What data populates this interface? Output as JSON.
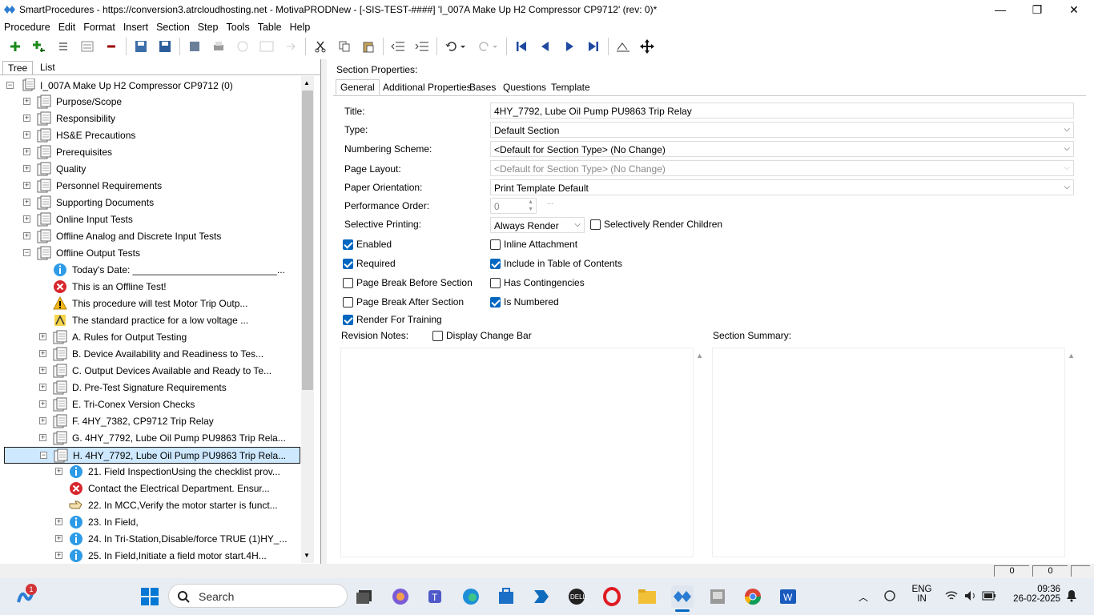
{
  "window": {
    "title": "SmartProcedures - https://conversion3.atrcloudhosting.net - MotivaPRODNew - [-SIS-TEST-####] 'I_007A Make Up H2 Compressor CP9712' (rev: 0)*",
    "minimize": "—",
    "maximize": "❐",
    "close": "✕"
  },
  "menu": [
    "Procedure",
    "Edit",
    "Format",
    "Insert",
    "Section",
    "Step",
    "Tools",
    "Table",
    "Help"
  ],
  "left_tabs": {
    "tree": "Tree",
    "list": "List"
  },
  "tree": {
    "root": "I_007A Make Up H2 Compressor CP9712 (0)",
    "rows": [
      {
        "label": "Purpose/Scope",
        "icon": "section-icon",
        "level": 1,
        "exp": "+"
      },
      {
        "label": "Responsibility",
        "icon": "section-icon",
        "level": 1,
        "exp": "+"
      },
      {
        "label": "HS&E Precautions",
        "icon": "section-icon",
        "level": 1,
        "exp": "+"
      },
      {
        "label": "Prerequisites",
        "icon": "section-icon",
        "level": 1,
        "exp": "+"
      },
      {
        "label": "Quality",
        "icon": "section-icon",
        "level": 1,
        "exp": "+"
      },
      {
        "label": "Personnel Requirements",
        "icon": "section-icon",
        "level": 1,
        "exp": "+"
      },
      {
        "label": "Supporting Documents",
        "icon": "section-icon",
        "level": 1,
        "exp": "+"
      },
      {
        "label": "Online Input Tests",
        "icon": "section-icon",
        "level": 1,
        "exp": "+"
      },
      {
        "label": "Offline Analog and Discrete Input Tests",
        "icon": "section-icon",
        "level": 1,
        "exp": "+"
      },
      {
        "label": "Offline Output Tests",
        "icon": "section-icon",
        "level": 1,
        "exp": "−"
      },
      {
        "label": "Today's Date: ___________________________...",
        "icon": "info-icon",
        "level": 2,
        "exp": ""
      },
      {
        "label": "This is an Offline Test!",
        "icon": "error-icon",
        "level": 2,
        "exp": ""
      },
      {
        "label": "This procedure will test Motor Trip Outp...",
        "icon": "warning-icon",
        "level": 2,
        "exp": ""
      },
      {
        "label": "The standard practice for a low voltage ...",
        "icon": "caution-icon",
        "level": 2,
        "exp": ""
      },
      {
        "label": "A. Rules for Output Testing",
        "icon": "section-icon",
        "level": 2,
        "exp": "+"
      },
      {
        "label": "B. Device Availability and Readiness to Tes...",
        "icon": "section-icon",
        "level": 2,
        "exp": "+"
      },
      {
        "label": "C. Output Devices Available and Ready to Te...",
        "icon": "section-icon",
        "level": 2,
        "exp": "+"
      },
      {
        "label": "D. Pre-Test Signature Requirements",
        "icon": "section-icon",
        "level": 2,
        "exp": "+"
      },
      {
        "label": "E. Tri-Conex Version Checks",
        "icon": "section-icon",
        "level": 2,
        "exp": "+"
      },
      {
        "label": "F. 4HY_7382, CP9712 Trip Relay",
        "icon": "section-icon",
        "level": 2,
        "exp": "+"
      },
      {
        "label": "G. 4HY_7792, Lube Oil Pump PU9863 Trip Rela...",
        "icon": "section-icon",
        "level": 2,
        "exp": "+"
      },
      {
        "label": "H. 4HY_7792, Lube Oil Pump PU9863 Trip Rela...",
        "icon": "section-icon",
        "level": 2,
        "exp": "−",
        "selected": true
      },
      {
        "label": "21. Field InspectionUsing the checklist prov...",
        "icon": "info-icon",
        "level": 3,
        "exp": "+"
      },
      {
        "label": "Contact the Electrical Department. Ensur...",
        "icon": "error-icon",
        "level": 3,
        "exp": ""
      },
      {
        "label": "22. In MCC,Verify the motor starter is funct...",
        "icon": "hand-icon",
        "level": 3,
        "exp": ""
      },
      {
        "label": "23. In Field,",
        "icon": "info-icon",
        "level": 3,
        "exp": "+"
      },
      {
        "label": "24. In Tri-Station,Disable/force TRUE (1)HY_...",
        "icon": "info-icon",
        "level": 3,
        "exp": "+"
      },
      {
        "label": "25. In Field,Initiate a field motor start.4H...",
        "icon": "info-icon",
        "level": 3,
        "exp": "+"
      }
    ]
  },
  "section": {
    "header": "Section Properties:",
    "tabs": [
      "General",
      "Additional Properties",
      "Bases",
      "Questions",
      "Template"
    ],
    "title_label": "Title:",
    "title_value": "4HY_7792, Lube Oil Pump PU9863 Trip Relay",
    "type_label": "Type:",
    "type_value": "Default Section",
    "numbering_label": "Numbering Scheme:",
    "numbering_value": "<Default for Section Type> (No Change)",
    "page_layout_label": "Page Layout:",
    "page_layout_value": "<Default for Section Type> (No Change)",
    "orientation_label": "Paper Orientation:",
    "orientation_value": "Print Template Default",
    "perf_label": "Performance Order:",
    "perf_value": "0",
    "perf_btn": "...",
    "selective_label": "Selective Printing:",
    "selective_value": "Always Render",
    "checks": {
      "selectively_render_children": {
        "label": "Selectively Render Children",
        "checked": false
      },
      "enabled": {
        "label": "Enabled",
        "checked": true
      },
      "inline_attachment": {
        "label": "Inline Attachment",
        "checked": false
      },
      "required": {
        "label": "Required",
        "checked": true
      },
      "include_toc": {
        "label": "Include in Table of Contents",
        "checked": true
      },
      "page_break_before": {
        "label": "Page Break Before Section",
        "checked": false
      },
      "has_contingencies": {
        "label": "Has Contingencies",
        "checked": false
      },
      "page_break_after": {
        "label": "Page Break After Section",
        "checked": false
      },
      "is_numbered": {
        "label": "Is Numbered",
        "checked": true
      },
      "render_training": {
        "label": "Render For Training",
        "checked": true
      },
      "display_change_bar": {
        "label": "Display Change Bar",
        "checked": false
      }
    },
    "revision_notes_label": "Revision Notes:",
    "summary_label": "Section Summary:"
  },
  "status": {
    "a": "0",
    "b": "0"
  },
  "taskbar": {
    "search": "Search",
    "lang1": "ENG",
    "lang2": "IN",
    "time": "09:36",
    "date": "26-02-2025",
    "badge": "1"
  }
}
